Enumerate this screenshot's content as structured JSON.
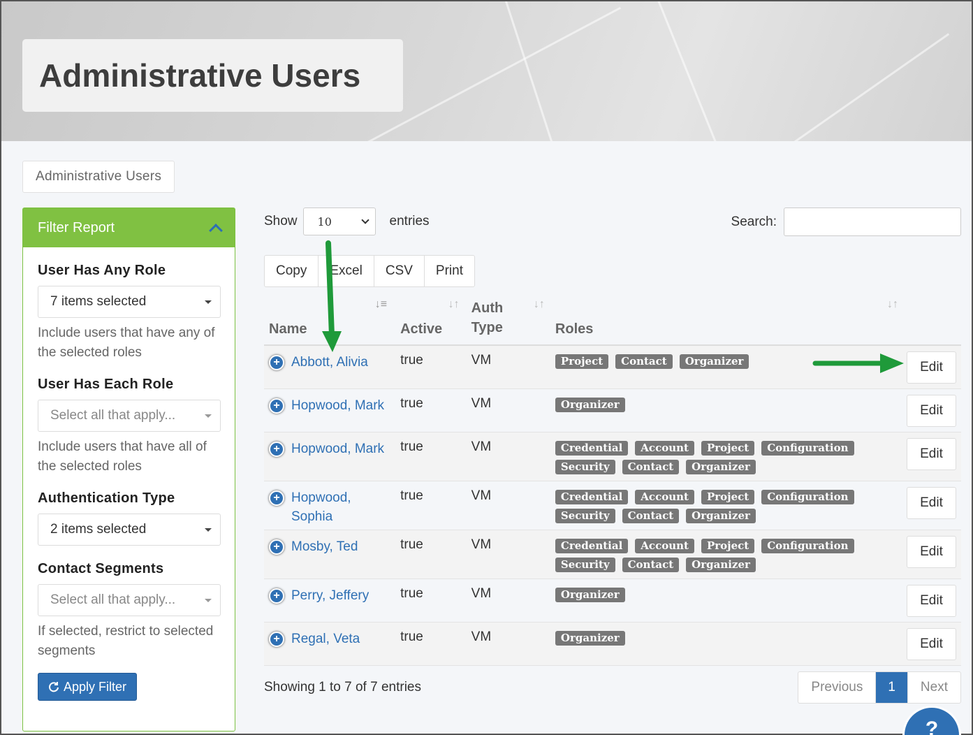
{
  "page": {
    "title": "Administrative Users",
    "breadcrumb": "Administrative Users"
  },
  "filter": {
    "header": "Filter Report",
    "groups": [
      {
        "label": "User Has Any Role",
        "value": "7 items selected",
        "help": "Include users that have any of the selected roles"
      },
      {
        "label": "User Has Each Role",
        "placeholder": "Select all that apply...",
        "help": "Include users that have all of the selected roles"
      },
      {
        "label": "Authentication Type",
        "value": "2 items selected"
      },
      {
        "label": "Contact Segments",
        "placeholder": "Select all that apply...",
        "help": "If selected, restrict to selected segments"
      }
    ],
    "apply_label": "Apply Filter"
  },
  "table_controls": {
    "show_label": "Show",
    "length_value": "10",
    "entries_label": "entries",
    "search_label": "Search:",
    "buttons": [
      "Copy",
      "Excel",
      "CSV",
      "Print"
    ]
  },
  "columns": {
    "name": "Name",
    "active": "Active",
    "auth_type": "Auth Type",
    "roles": "Roles"
  },
  "rows": [
    {
      "name": "Abbott, Alivia",
      "active": "true",
      "auth": "VM",
      "roles": [
        "Project",
        "Contact",
        "Organizer"
      ],
      "edit": "Edit"
    },
    {
      "name": "Hopwood, Mark",
      "active": "true",
      "auth": "VM",
      "roles": [
        "Organizer"
      ],
      "edit": "Edit"
    },
    {
      "name": "Hopwood, Mark",
      "active": "true",
      "auth": "VM",
      "roles": [
        "Credential",
        "Account",
        "Project",
        "Configuration",
        "Security",
        "Contact",
        "Organizer"
      ],
      "edit": "Edit"
    },
    {
      "name": "Hopwood, Sophia",
      "active": "true",
      "auth": "VM",
      "roles": [
        "Credential",
        "Account",
        "Project",
        "Configuration",
        "Security",
        "Contact",
        "Organizer"
      ],
      "edit": "Edit"
    },
    {
      "name": "Mosby, Ted",
      "active": "true",
      "auth": "VM",
      "roles": [
        "Credential",
        "Account",
        "Project",
        "Configuration",
        "Security",
        "Contact",
        "Organizer"
      ],
      "edit": "Edit"
    },
    {
      "name": "Perry, Jeffery",
      "active": "true",
      "auth": "VM",
      "roles": [
        "Organizer"
      ],
      "edit": "Edit"
    },
    {
      "name": "Regal, Veta",
      "active": "true",
      "auth": "VM",
      "roles": [
        "Organizer"
      ],
      "edit": "Edit"
    }
  ],
  "footer": {
    "info": "Showing 1 to 7 of 7 entries",
    "previous": "Previous",
    "current_page": "1",
    "next": "Next"
  },
  "colors": {
    "accent_green": "#80c142",
    "primary_blue": "#2f70b4",
    "annotation_arrow": "#1f9a3a"
  }
}
